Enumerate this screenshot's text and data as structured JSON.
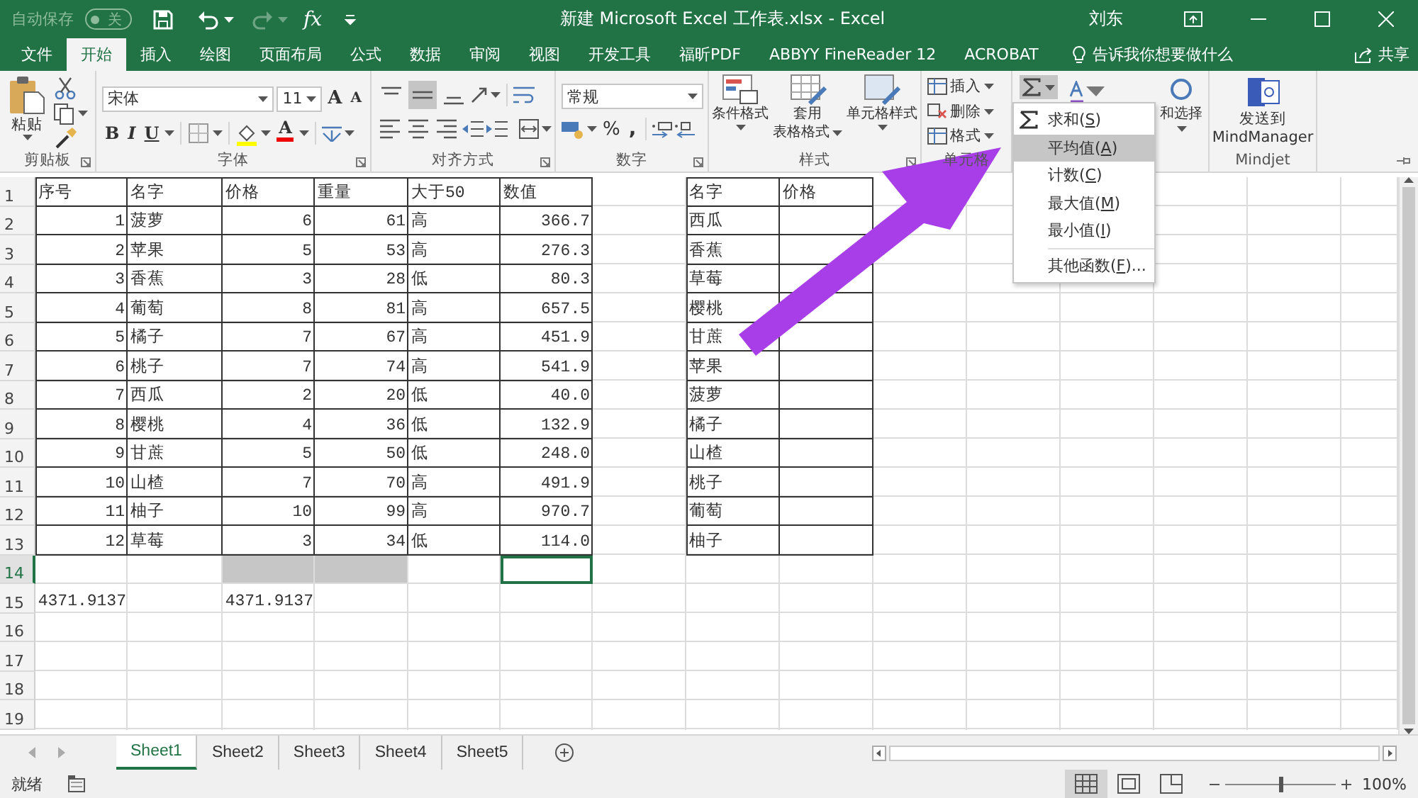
{
  "title_bar": {
    "autosave_label": "自动保存",
    "autosave_toggle": {
      "text": "关",
      "on": false
    },
    "formula_symbol": "fx",
    "title": "新建 Microsoft Excel 工作表.xlsx  -  Excel",
    "user": "刘东"
  },
  "tabs": [
    {
      "label": "文件",
      "selected": false
    },
    {
      "label": "开始",
      "selected": true
    },
    {
      "label": "插入",
      "selected": false
    },
    {
      "label": "绘图",
      "selected": false
    },
    {
      "label": "页面布局",
      "selected": false
    },
    {
      "label": "公式",
      "selected": false
    },
    {
      "label": "数据",
      "selected": false
    },
    {
      "label": "审阅",
      "selected": false
    },
    {
      "label": "视图",
      "selected": false
    },
    {
      "label": "开发工具",
      "selected": false
    },
    {
      "label": "福昕PDF",
      "selected": false
    },
    {
      "label": "ABBYY FineReader 12",
      "selected": false
    },
    {
      "label": "ACROBAT",
      "selected": false
    }
  ],
  "tell_me": "告诉我你想要做什么",
  "share": "共享",
  "ribbon": {
    "clipboard": {
      "paste": "粘贴",
      "label": "剪贴板"
    },
    "font": {
      "font_name": "宋体",
      "font_size": "11",
      "grow": "A",
      "shrink": "A",
      "bold": "B",
      "italic": "I",
      "underline": "U",
      "font_color": "A",
      "label": "字体"
    },
    "alignment": {
      "vertical": [
        {
          "kind": "top",
          "selected": false
        },
        {
          "kind": "middle",
          "selected": true
        },
        {
          "kind": "bottom",
          "selected": false
        }
      ],
      "horizontal": [
        {
          "kind": "left",
          "selected": false
        },
        {
          "kind": "center",
          "selected": false
        },
        {
          "kind": "right",
          "selected": false
        }
      ],
      "label": "对齐方式"
    },
    "number": {
      "format": "常规",
      "percent": "%",
      "comma": ",",
      "label": "数字"
    },
    "styles": {
      "buttons": [
        {
          "lines": [
            "条件格式"
          ]
        },
        {
          "lines": [
            "套用",
            "表格格式"
          ]
        },
        {
          "lines": [
            "单元格样式"
          ]
        }
      ],
      "label": "样式"
    },
    "cells": {
      "buttons": [
        "插入",
        "删除",
        "格式"
      ],
      "label": "单元格"
    },
    "editing": {
      "autosum_open": true,
      "find_label": "和选择"
    },
    "mindjet": {
      "button_lines": [
        "发送到",
        "MindManager"
      ],
      "label": "Mindjet"
    }
  },
  "autosum_menu": {
    "items": [
      {
        "text": "求和(",
        "accel": "S",
        "tail": ")",
        "selected": false
      },
      {
        "text": "平均值(",
        "accel": "A",
        "tail": ")",
        "selected": true
      },
      {
        "text": "计数(",
        "accel": "C",
        "tail": ")",
        "selected": false
      },
      {
        "text": "最大值(",
        "accel": "M",
        "tail": ")",
        "selected": false
      },
      {
        "text": "最小值(",
        "accel": "I",
        "tail": ")",
        "selected": false
      },
      {
        "text": "其他函数(",
        "accel": "F",
        "tail": ")...",
        "selected": false
      }
    ]
  },
  "sheet": {
    "rows": [
      {
        "number": "1",
        "selected": false,
        "header": true,
        "bordered": true,
        "cells": [
          "序号",
          "名字",
          "价格",
          "重量",
          "大于50",
          "数值",
          null,
          "名字",
          "价格"
        ]
      },
      {
        "number": "2",
        "selected": false,
        "header": false,
        "bordered": true,
        "cells": [
          "1",
          "菠萝",
          "6",
          "61",
          "高",
          "366.7",
          null,
          "西瓜",
          null
        ]
      },
      {
        "number": "3",
        "selected": false,
        "header": false,
        "bordered": true,
        "cells": [
          "2",
          "苹果",
          "5",
          "53",
          "高",
          "276.3",
          null,
          "香蕉",
          null
        ]
      },
      {
        "number": "4",
        "selected": false,
        "header": false,
        "bordered": true,
        "cells": [
          "3",
          "香蕉",
          "3",
          "28",
          "低",
          "80.3",
          null,
          "草莓",
          null
        ]
      },
      {
        "number": "5",
        "selected": false,
        "header": false,
        "bordered": true,
        "cells": [
          "4",
          "葡萄",
          "8",
          "81",
          "高",
          "657.5",
          null,
          "樱桃",
          null
        ]
      },
      {
        "number": "6",
        "selected": false,
        "header": false,
        "bordered": true,
        "cells": [
          "5",
          "橘子",
          "7",
          "67",
          "高",
          "451.9",
          null,
          "甘蔗",
          null
        ]
      },
      {
        "number": "7",
        "selected": false,
        "header": false,
        "bordered": true,
        "cells": [
          "6",
          "桃子",
          "7",
          "74",
          "高",
          "541.9",
          null,
          "苹果",
          null
        ]
      },
      {
        "number": "8",
        "selected": false,
        "header": false,
        "bordered": true,
        "cells": [
          "7",
          "西瓜",
          "2",
          "20",
          "低",
          "40.0",
          null,
          "菠萝",
          null
        ]
      },
      {
        "number": "9",
        "selected": false,
        "header": false,
        "bordered": true,
        "cells": [
          "8",
          "樱桃",
          "4",
          "36",
          "低",
          "132.9",
          null,
          "橘子",
          null
        ]
      },
      {
        "number": "10",
        "selected": false,
        "header": false,
        "bordered": true,
        "cells": [
          "9",
          "甘蔗",
          "5",
          "50",
          "低",
          "248.0",
          null,
          "山楂",
          null
        ]
      },
      {
        "number": "11",
        "selected": false,
        "header": false,
        "bordered": true,
        "cells": [
          "10",
          "山楂",
          "7",
          "70",
          "高",
          "491.9",
          null,
          "桃子",
          null
        ]
      },
      {
        "number": "12",
        "selected": false,
        "header": false,
        "bordered": true,
        "cells": [
          "11",
          "柚子",
          "10",
          "99",
          "高",
          "970.7",
          null,
          "葡萄",
          null
        ]
      },
      {
        "number": "13",
        "selected": false,
        "header": false,
        "bordered": true,
        "cells": [
          "12",
          "草莓",
          "3",
          "34",
          "低",
          "114.0",
          null,
          "柚子",
          null
        ]
      },
      {
        "number": "14",
        "selected": true,
        "bordered": false,
        "cells": [
          null,
          null,
          {
            "kind": "range"
          },
          {
            "kind": "range"
          },
          null,
          {
            "kind": "active"
          }
        ]
      },
      {
        "number": "15",
        "selected": false,
        "header": false,
        "bordered": false,
        "cells": [
          "4371.9137",
          null,
          "4371.9137"
        ]
      },
      {
        "number": "16",
        "selected": false,
        "bordered": false,
        "cells": []
      },
      {
        "number": "17",
        "selected": false,
        "bordered": false,
        "cells": []
      },
      {
        "number": "18",
        "selected": false,
        "bordered": false,
        "cells": []
      },
      {
        "number": "19",
        "selected": false,
        "bordered": false,
        "cells": []
      }
    ]
  },
  "sheet_tabs": [
    {
      "label": "Sheet1",
      "selected": true
    },
    {
      "label": "Sheet2",
      "selected": false
    },
    {
      "label": "Sheet3",
      "selected": false
    },
    {
      "label": "Sheet4",
      "selected": false
    },
    {
      "label": "Sheet5",
      "selected": false
    }
  ],
  "status_bar": {
    "status": "就绪",
    "views": [
      {
        "kind": "normal",
        "selected": true
      },
      {
        "kind": "page_layout",
        "selected": false
      },
      {
        "kind": "page_break",
        "selected": false
      }
    ],
    "zoom": {
      "level": 0.5,
      "text": "100%"
    }
  }
}
